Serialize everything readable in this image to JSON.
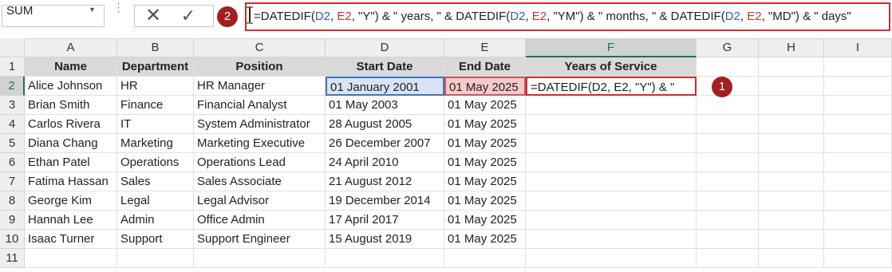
{
  "formula_bar": {
    "name_box": "SUM",
    "cancel_icon": "✕",
    "enter_icon": "✓",
    "formula_parts": [
      {
        "text": "=DATEDIF(",
        "ref": ""
      },
      {
        "text": "D2",
        "ref": "blue"
      },
      {
        "text": ", ",
        "ref": ""
      },
      {
        "text": "E2",
        "ref": "red"
      },
      {
        "text": ", \"Y\") & \" years, \" & DATEDIF(",
        "ref": ""
      },
      {
        "text": "D2",
        "ref": "blue"
      },
      {
        "text": ", ",
        "ref": ""
      },
      {
        "text": "E2",
        "ref": "red"
      },
      {
        "text": ", \"YM\") & \" months, \" & DATEDIF(",
        "ref": ""
      },
      {
        "text": "D2",
        "ref": "blue"
      },
      {
        "text": ", ",
        "ref": ""
      },
      {
        "text": "E2",
        "ref": "red"
      },
      {
        "text": ", \"MD\") & \" days\"",
        "ref": ""
      }
    ]
  },
  "callouts": {
    "one": "1",
    "two": "2"
  },
  "columns": [
    "A",
    "B",
    "C",
    "D",
    "E",
    "F",
    "G",
    "H",
    "I"
  ],
  "row_numbers": [
    "1",
    "2",
    "3",
    "4",
    "5",
    "6",
    "7",
    "8",
    "9",
    "10",
    "11"
  ],
  "table": {
    "headers": [
      "Name",
      "Department",
      "Position",
      "Start Date",
      "End Date",
      "Years of Service"
    ],
    "rows": [
      [
        "Alice Johnson",
        "HR",
        "HR Manager",
        "01 January 2001",
        "01 May 2025",
        "=DATEDIF(D2, E2, \"Y\") & \""
      ],
      [
        "Brian Smith",
        "Finance",
        "Financial Analyst",
        "01 May 2003",
        "01 May 2025",
        ""
      ],
      [
        "Carlos Rivera",
        "IT",
        "System Administrator",
        "28 August 2005",
        "01 May 2025",
        ""
      ],
      [
        "Diana Chang",
        "Marketing",
        "Marketing Executive",
        "26 December 2007",
        "01 May 2025",
        ""
      ],
      [
        "Ethan Patel",
        "Operations",
        "Operations Lead",
        "24 April 2010",
        "01 May 2025",
        ""
      ],
      [
        "Fatima Hassan",
        "Sales",
        "Sales Associate",
        "21 August 2012",
        "01 May 2025",
        ""
      ],
      [
        "George Kim",
        "Legal",
        "Legal Advisor",
        "19 December 2014",
        "01 May 2025",
        ""
      ],
      [
        "Hannah Lee",
        "Admin",
        "Office Admin",
        "17 April 2017",
        "01 May 2025",
        ""
      ],
      [
        "Isaac Turner",
        "Support",
        "Support Engineer",
        "15 August 2019",
        "01 May 2025",
        ""
      ]
    ]
  },
  "colors": {
    "accent_green": "#217346",
    "callout_red": "#a31f1f",
    "ref_blue": "#2a5fb8",
    "ref_red": "#c33535"
  }
}
